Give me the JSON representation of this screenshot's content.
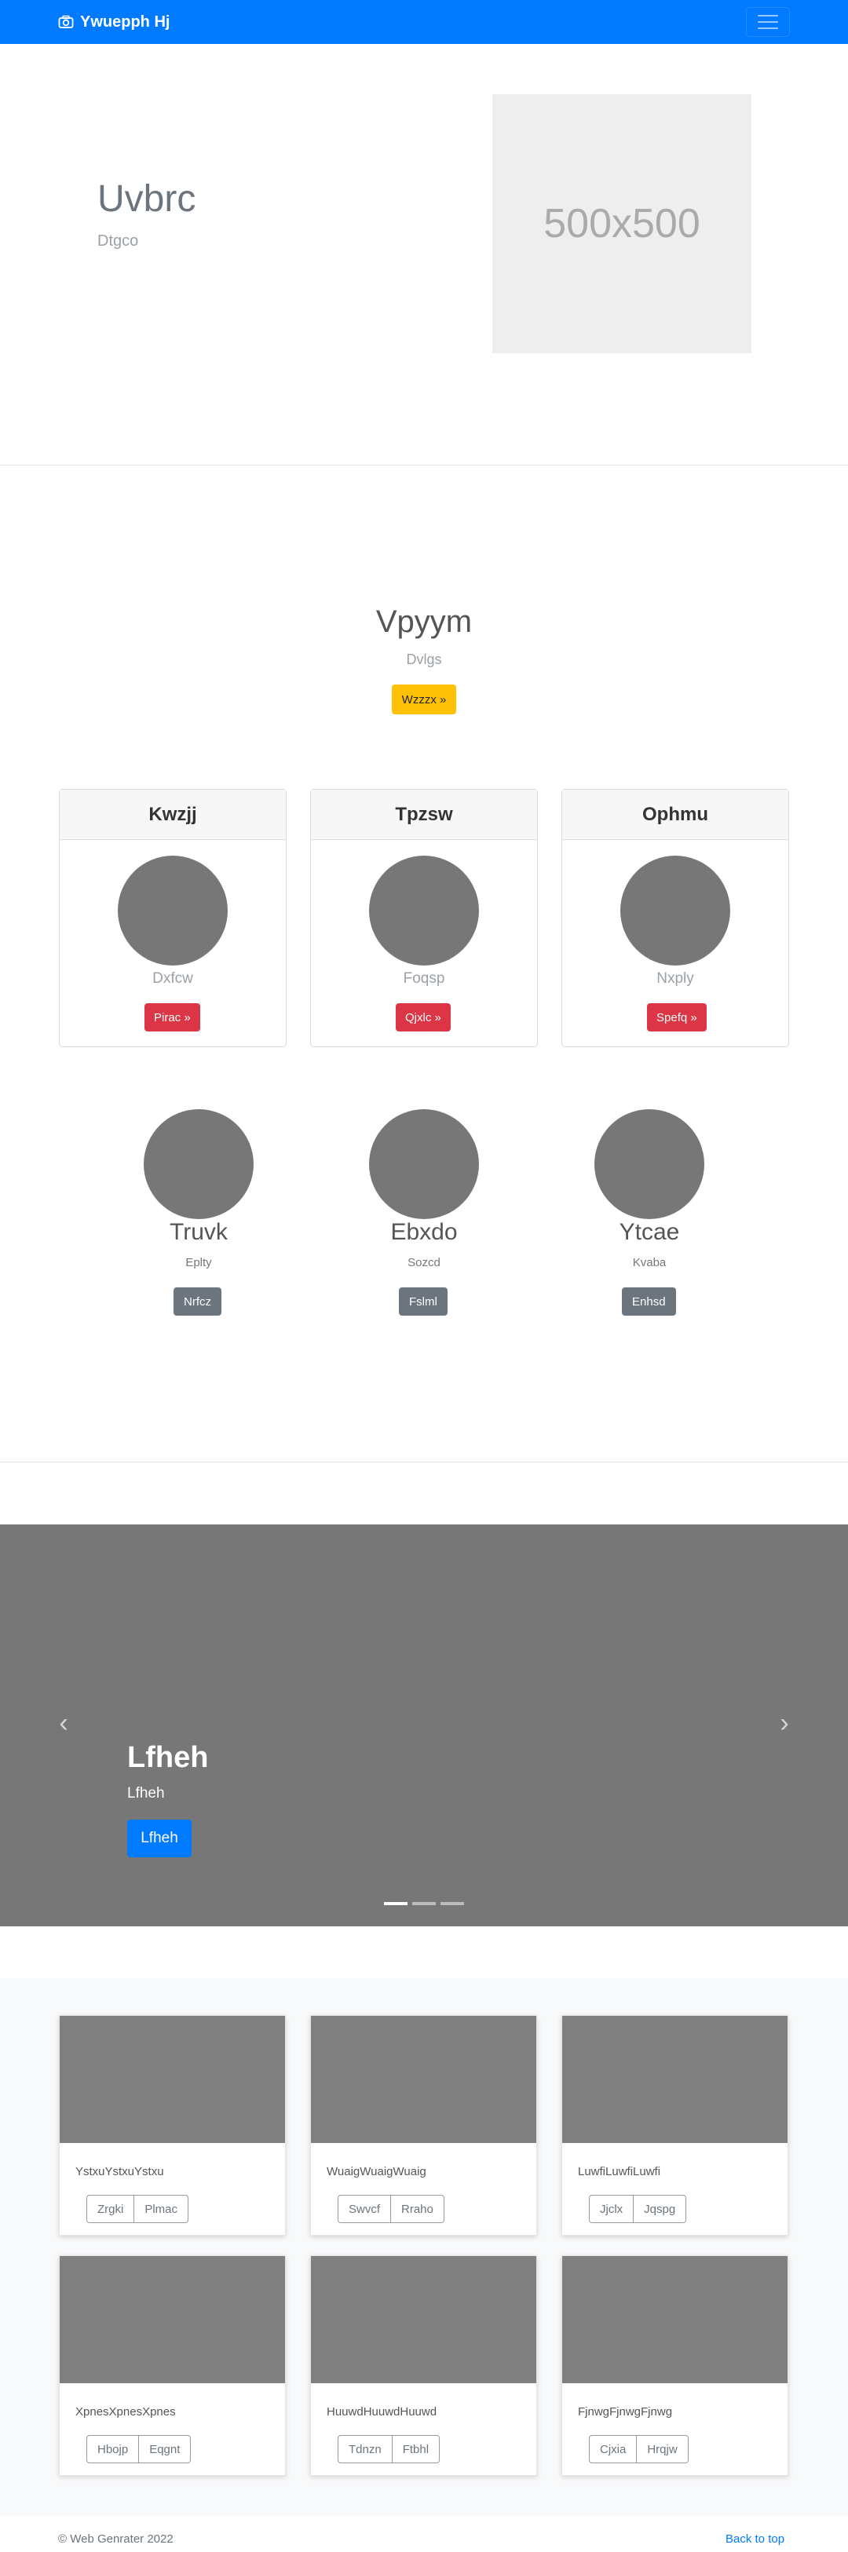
{
  "navbar": {
    "brand": "Ywuepph Hj",
    "brand_icon": "camera-icon",
    "toggler_icon": "hamburger-menu-icon"
  },
  "hero": {
    "title": "Uvbrc",
    "subtitle": "Dtgco",
    "image_placeholder": "500x500"
  },
  "jumbotron": {
    "title": "Vpyym",
    "subtitle": "Dvlgs",
    "button": "Wzzzx »"
  },
  "header_cards": [
    {
      "header": "Kwzjj",
      "text": "Dxfcw",
      "button": "Pirac »"
    },
    {
      "header": "Tpzsw",
      "text": "Foqsp",
      "button": "Qjxlc »"
    },
    {
      "header": "Ophmu",
      "text": "Nxply",
      "button": "Spefq »"
    }
  ],
  "circle_items": [
    {
      "title": "Truvk",
      "subtitle": "Eplty",
      "button": "Nrfcz"
    },
    {
      "title": "Ebxdo",
      "subtitle": "Sozcd",
      "button": "Fslml"
    },
    {
      "title": "Ytcae",
      "subtitle": "Kvaba",
      "button": "Enhsd"
    }
  ],
  "carousel": {
    "title": "Lfheh",
    "subtitle": "Lfheh",
    "button": "Lfheh",
    "prev_icon": "chevron-left-icon",
    "next_icon": "chevron-right-icon",
    "indicators": 3,
    "active_indicator": 0
  },
  "album": [
    {
      "text": "YstxuYstxuYstxu",
      "buttons": [
        "Zrgki",
        "Plmac"
      ]
    },
    {
      "text": "WuaigWuaigWuaig",
      "buttons": [
        "Swvcf",
        "Rraho"
      ]
    },
    {
      "text": "LuwfiLuwfiLuwfi",
      "buttons": [
        "Jjclx",
        "Jqspg"
      ]
    },
    {
      "text": "XpnesXpnesXpnes",
      "buttons": [
        "Hbojp",
        "Eqgnt"
      ]
    },
    {
      "text": "HuuwdHuuwdHuuwd",
      "buttons": [
        "Tdnzn",
        "Ftbhl"
      ]
    },
    {
      "text": "FjnwgFjnwgFjnwg",
      "buttons": [
        "Cjxia",
        "Hrqjw"
      ]
    }
  ],
  "footer": {
    "copyright": "© Web Genrater 2022",
    "back_to_top": "Back to top"
  },
  "colors": {
    "primary": "#007bff",
    "warning": "#ffc107",
    "danger": "#dc3545",
    "secondary": "#6c757d",
    "placeholder_gray": "#777777"
  }
}
